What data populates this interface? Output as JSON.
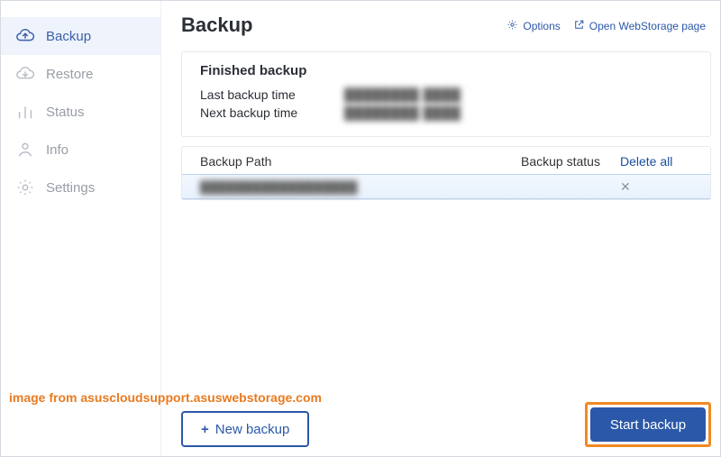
{
  "sidebar": {
    "items": [
      {
        "key": "backup",
        "label": "Backup",
        "icon": "cloud-up-icon",
        "active": true
      },
      {
        "key": "restore",
        "label": "Restore",
        "icon": "cloud-down-icon",
        "active": false
      },
      {
        "key": "status",
        "label": "Status",
        "icon": "bar-chart-icon",
        "active": false
      },
      {
        "key": "info",
        "label": "Info",
        "icon": "person-icon",
        "active": false
      },
      {
        "key": "settings",
        "label": "Settings",
        "icon": "gear-icon",
        "active": false
      }
    ]
  },
  "header": {
    "title": "Backup",
    "options_label": "Options",
    "open_webstorage_label": "Open WebStorage page"
  },
  "finished": {
    "title": "Finished backup",
    "last_label": "Last backup time",
    "last_value": "████████ ████",
    "next_label": "Next backup time",
    "next_value": "████████ ████"
  },
  "table": {
    "col_path": "Backup Path",
    "col_status": "Backup status",
    "delete_all": "Delete all",
    "rows": [
      {
        "path": "██████████████████",
        "status": ""
      }
    ]
  },
  "footer": {
    "new_backup_label": "New  backup",
    "start_backup_label": "Start backup"
  },
  "attribution": "image from asuscloudsupport.asuswebstorage.com"
}
